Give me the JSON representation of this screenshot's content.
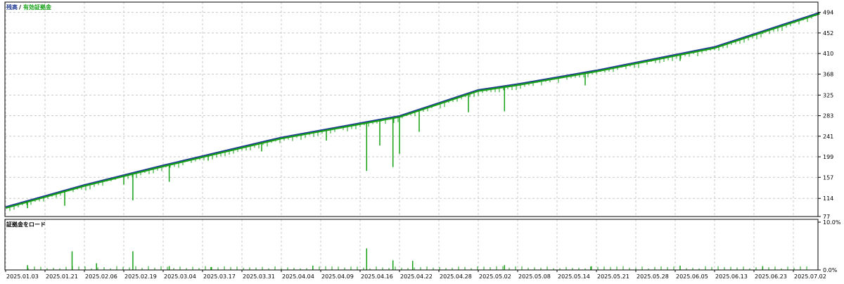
{
  "legend": {
    "balance_label": "残高",
    "separator": "/",
    "equity_label": "有効証拠金"
  },
  "lower_panel": {
    "title": "証拠金をロード"
  },
  "colors": {
    "balance": "#1f3a93",
    "equity": "#16a016",
    "load": "#16a016",
    "grid": "#c8c8c8",
    "axis": "#000000",
    "text": "#000000"
  },
  "chart_data": [
    {
      "type": "line",
      "title": "",
      "series": [
        {
          "name": "残高",
          "color": "#1f3a93",
          "x": [
            "2025.01.03",
            "2025.02.06",
            "2025.03.04",
            "2025.04.04",
            "2025.04.22",
            "2025.05.02",
            "2025.05.08",
            "2025.05.21",
            "2025.06.13",
            "2025.07.08"
          ],
          "y": [
            97,
            142,
            182,
            239,
            283,
            336,
            348,
            376,
            424,
            494
          ]
        }
      ],
      "equity_drawdowns": [
        {
          "x": "2025.01.13",
          "y": 94
        },
        {
          "x": "2025.01.29",
          "y": 99
        },
        {
          "x": "2025.02.22",
          "y": 110
        },
        {
          "x": "2025.02.19",
          "y": 142
        },
        {
          "x": "2025.03.06",
          "y": 148
        },
        {
          "x": "2025.03.19",
          "y": 192
        },
        {
          "x": "2025.04.02",
          "y": 210
        },
        {
          "x": "2025.04.10",
          "y": 232
        },
        {
          "x": "2025.04.17",
          "y": 170
        },
        {
          "x": "2025.04.19",
          "y": 222
        },
        {
          "x": "2025.04.21",
          "y": 178
        },
        {
          "x": "2025.04.22",
          "y": 205
        },
        {
          "x": "2025.04.25",
          "y": 250
        },
        {
          "x": "2025.05.01",
          "y": 290
        },
        {
          "x": "2025.05.06",
          "y": 292
        },
        {
          "x": "2025.05.19",
          "y": 345
        },
        {
          "x": "2025.06.06",
          "y": 395
        },
        {
          "x": "2025.06.25",
          "y": 450
        }
      ],
      "y_ticks": [
        "77",
        "114",
        "157",
        "199",
        "241",
        "283",
        "325",
        "368",
        "410",
        "452",
        "494"
      ],
      "ylim": [
        77,
        515
      ],
      "x_ticks": [
        "2025.01.03",
        "2025.01.21",
        "2025.02.06",
        "2025.02.19",
        "2025.03.04",
        "2025.03.17",
        "2025.03.31",
        "2025.04.04",
        "2025.04.09",
        "2025.04.16",
        "2025.04.22",
        "2025.04.28",
        "2025.05.02",
        "2025.05.08",
        "2025.05.14",
        "2025.05.21",
        "2025.05.28",
        "2025.06.05",
        "2025.06.13",
        "2025.06.23",
        "2025.07.02"
      ],
      "grid": true,
      "legend_position": "top-left"
    },
    {
      "type": "bar",
      "title": "証拠金をロード",
      "y_ticks": [
        "0.0%",
        "10.0%"
      ],
      "ylim": [
        0,
        10
      ],
      "unit": "%",
      "bars": [
        {
          "x": "2025.01.13",
          "value": 1.0
        },
        {
          "x": "2025.02.01",
          "value": 3.9
        },
        {
          "x": "2025.02.10",
          "value": 1.4
        },
        {
          "x": "2025.02.22",
          "value": 3.9
        },
        {
          "x": "2025.03.06",
          "value": 0.8
        },
        {
          "x": "2025.03.20",
          "value": 0.6
        },
        {
          "x": "2025.04.08",
          "value": 0.9
        },
        {
          "x": "2025.04.17",
          "value": 4.5
        },
        {
          "x": "2025.04.21",
          "value": 2.0
        },
        {
          "x": "2025.04.24",
          "value": 1.9
        },
        {
          "x": "2025.05.06",
          "value": 1.0
        },
        {
          "x": "2025.05.20",
          "value": 0.7
        },
        {
          "x": "2025.06.06",
          "value": 0.9
        },
        {
          "x": "2025.06.25",
          "value": 0.8
        }
      ],
      "x_ticks": [
        "2025.01.03",
        "2025.01.21",
        "2025.02.06",
        "2025.02.19",
        "2025.03.04",
        "2025.03.17",
        "2025.03.31",
        "2025.04.04",
        "2025.04.09",
        "2025.04.16",
        "2025.04.22",
        "2025.04.28",
        "2025.05.02",
        "2025.05.08",
        "2025.05.14",
        "2025.05.21",
        "2025.05.28",
        "2025.06.05",
        "2025.06.13",
        "2025.06.23",
        "2025.07.02"
      ],
      "grid": true
    }
  ]
}
